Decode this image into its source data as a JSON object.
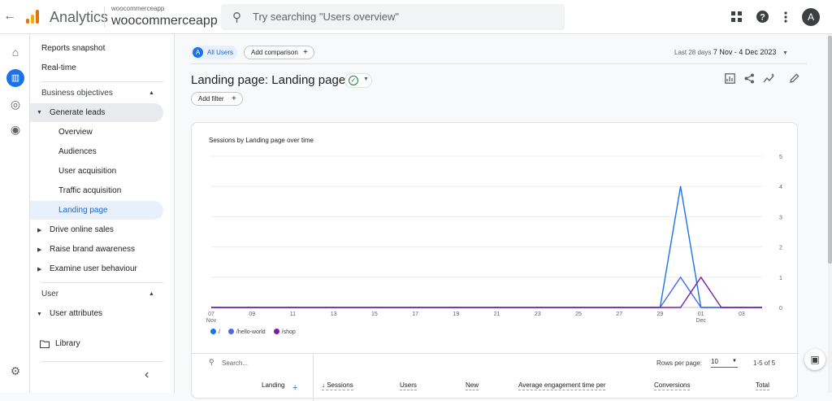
{
  "header": {
    "back_icon": "←",
    "brand": "Analytics",
    "account_small": "woocommerceapp",
    "account_big": "woocommerceapp",
    "search_placeholder": "Try searching \"Users overview\"",
    "icons": [
      "apps-grid-icon",
      "help-icon",
      "more-vert-icon"
    ],
    "avatar_letter": "A",
    "logo_colors": [
      "#f9ab00",
      "#e37400"
    ]
  },
  "rail": [
    "home-icon",
    "reports-icon",
    "explore-icon",
    "advertising-icon",
    "settings-icon"
  ],
  "sidebar": {
    "reports_snapshot": "Reports snapshot",
    "realtime": "Real-time",
    "business_objectives": "Business objectives",
    "generate_leads": "Generate leads",
    "sub_items": [
      "Overview",
      "Audiences",
      "User acquisition",
      "Traffic acquisition",
      "Landing page"
    ],
    "drive_online_sales": "Drive online sales",
    "raise_brand_awareness": "Raise brand awareness",
    "examine_user_behaviour": "Examine user behaviour",
    "user_section": "User",
    "user_attributes": "User attributes",
    "library": "Library",
    "collapse_icon": "‹"
  },
  "toolbar": {
    "all_users_badge": "A",
    "all_users": "All Users",
    "add_comparison": "Add comparison",
    "date_label": "Last 28 days",
    "date_range": "7 Nov - 4 Dec 2023"
  },
  "page": {
    "title": "Landing page: Landing page",
    "add_filter": "Add filter"
  },
  "chart_card": {
    "title": "Sessions by Landing page over time",
    "legend": [
      "/",
      "/hello-world",
      "/shop"
    ],
    "table_search_placeholder": "Search...",
    "rows_per_page_label": "Rows per page:",
    "rows_per_page_value": "10",
    "pagination": "1-5 of 5",
    "columns": [
      "Landing",
      "↓ Sessions",
      "Users",
      "New",
      "Average engagement time per",
      "Conversions",
      "Total"
    ]
  },
  "colors": {
    "accent": "#1a73e8",
    "series": [
      "#1a73e8",
      "#4f68e8",
      "#7b1fa2"
    ]
  },
  "chart_data": {
    "type": "line",
    "title": "Sessions by Landing page over time",
    "x": [
      "07 Nov",
      "08",
      "09",
      "10",
      "11",
      "12",
      "13",
      "14",
      "15",
      "16",
      "17",
      "18",
      "19",
      "20",
      "21",
      "22",
      "23",
      "24",
      "25",
      "26",
      "27",
      "28",
      "29",
      "30",
      "01 Dec",
      "02",
      "03",
      "04"
    ],
    "x_ticks": [
      "07",
      "09",
      "11",
      "13",
      "15",
      "17",
      "19",
      "21",
      "23",
      "25",
      "27",
      "29",
      "01",
      "03"
    ],
    "x_tick_sub": {
      "07": "Nov",
      "01": "Dec"
    },
    "y_ticks": [
      0,
      1,
      2,
      3,
      4,
      5
    ],
    "ylim": [
      0,
      5
    ],
    "series": [
      {
        "name": "/",
        "color": "#1a73e8",
        "values": [
          0,
          0,
          0,
          0,
          0,
          0,
          0,
          0,
          0,
          0,
          0,
          0,
          0,
          0,
          0,
          0,
          0,
          0,
          0,
          0,
          0,
          0,
          0,
          4,
          0,
          0,
          0,
          0
        ]
      },
      {
        "name": "/hello-world",
        "color": "#4f68e8",
        "values": [
          0,
          0,
          0,
          0,
          0,
          0,
          0,
          0,
          0,
          0,
          0,
          0,
          0,
          0,
          0,
          0,
          0,
          0,
          0,
          0,
          0,
          0,
          0,
          1,
          0,
          0,
          0,
          0
        ]
      },
      {
        "name": "/shop",
        "color": "#7b1fa2",
        "values": [
          0,
          0,
          0,
          0,
          0,
          0,
          0,
          0,
          0,
          0,
          0,
          0,
          0,
          0,
          0,
          0,
          0,
          0,
          0,
          0,
          0,
          0,
          0,
          0,
          1,
          0,
          0,
          0
        ]
      }
    ]
  }
}
